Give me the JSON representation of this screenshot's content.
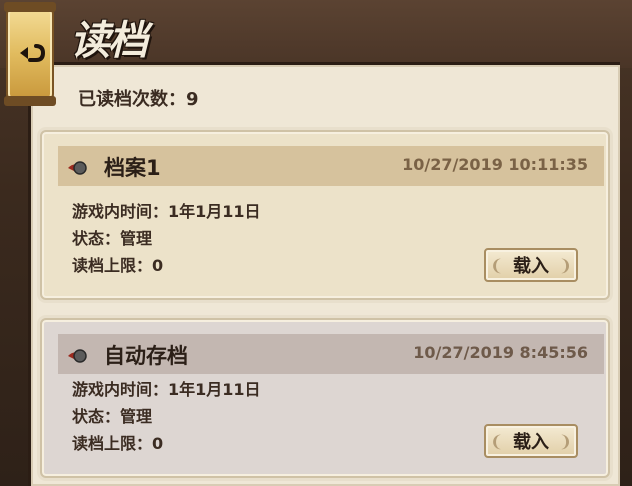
{
  "header": {
    "title": "读档"
  },
  "read_count": {
    "text": "已读档次数：9"
  },
  "back_button": {
    "icon": "back-arrow-icon"
  },
  "saves": [
    {
      "name": "档案1",
      "date": "10/27/2019 10:11:35",
      "game_time": "游戏内时间：1年1月11日",
      "status": "状态：管理",
      "limit": "读档上限：0",
      "load_label": "载入"
    },
    {
      "name": "自动存档",
      "date": "10/27/2019 8:45:56",
      "game_time": "游戏内时间：1年1月11日",
      "status": "状态：管理",
      "limit": "读档上限：0",
      "load_label": "载入"
    }
  ],
  "colors": {
    "panel": "#efe7d6",
    "card1_header": "#d6c29d",
    "card2_header": "#c3b7b1",
    "button_gold": "#e1bb5e"
  }
}
